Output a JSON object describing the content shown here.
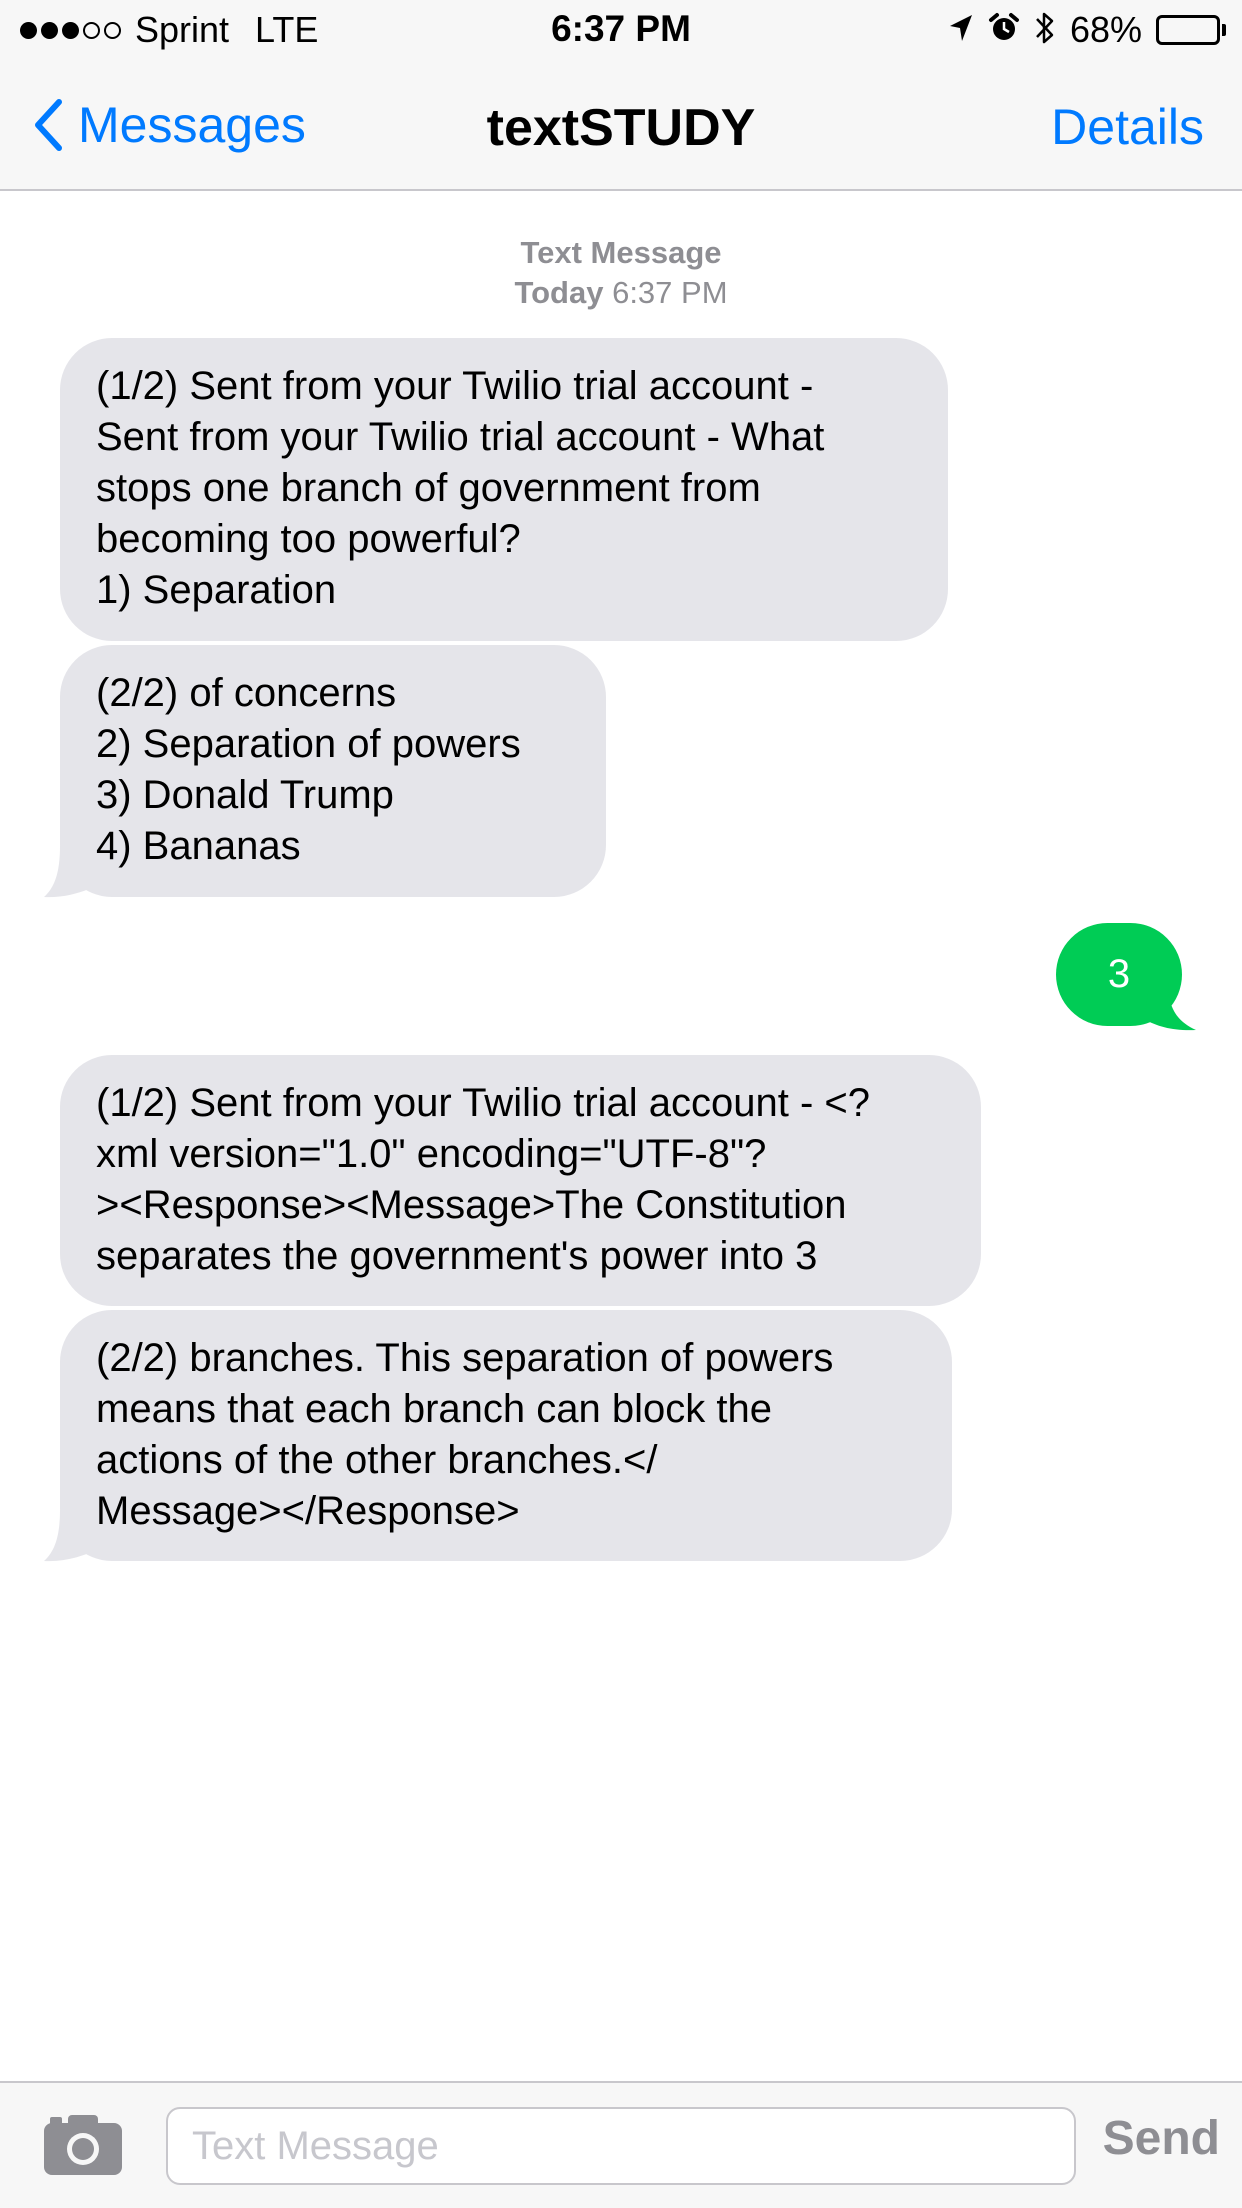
{
  "status_bar": {
    "signal_dots_full": 3,
    "signal_dots_total": 5,
    "carrier": "Sprint",
    "network": "LTE",
    "time": "6:37 PM",
    "icons": [
      "location-arrow-icon",
      "alarm-icon",
      "bluetooth-icon"
    ],
    "battery_percent_text": "68%",
    "battery_level": 0.68
  },
  "nav": {
    "back_label": "Messages",
    "title": "textSTUDY",
    "details_label": "Details"
  },
  "conversation": {
    "timestamp": {
      "label": "Text Message",
      "day": "Today",
      "time": "6:37 PM"
    },
    "messages": [
      {
        "direction": "incoming",
        "text": "(1/2) Sent from your Twilio trial account -\nSent from your Twilio trial account - What\nstops one branch of government from\nbecoming too powerful?\n1) Separation"
      },
      {
        "direction": "incoming",
        "text": "(2/2) of concerns\n2) Separation of powers\n3) Donald Trump\n4) Bananas"
      },
      {
        "direction": "outgoing",
        "text": "3"
      },
      {
        "direction": "incoming",
        "text": "(1/2) Sent from your Twilio trial account - <?\nxml version=\"1.0\" encoding=\"UTF-8\"?\n><Response><Message>The Constitution\nseparates the government's power into 3"
      },
      {
        "direction": "incoming",
        "text": "(2/2) branches. This separation of powers\nmeans that each branch can block the\nactions of the other branches.</\nMessage></Response>"
      }
    ]
  },
  "input_bar": {
    "placeholder": "Text Message",
    "value": "",
    "send_label": "Send"
  },
  "colors": {
    "accent_blue": "#007aff",
    "incoming_bubble": "#e5e5ea",
    "outgoing_bubble": "#00cc55",
    "meta_gray": "#8e8e93"
  }
}
